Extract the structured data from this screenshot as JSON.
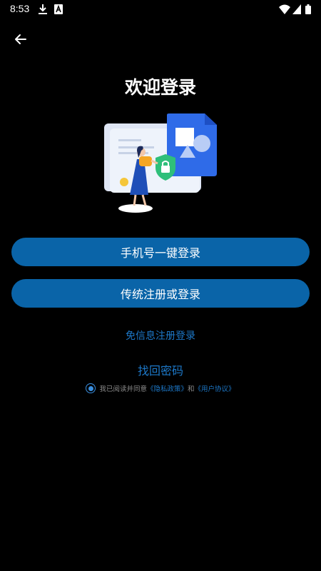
{
  "status_bar": {
    "time": "8:53"
  },
  "header": {
    "title": "欢迎登录"
  },
  "actions": {
    "phone_login_label": "手机号一键登录",
    "classic_login_label": "传统注册或登录",
    "quick_register_label": "免信息注册登录",
    "forgot_password_label": "找回密码"
  },
  "agreement": {
    "prefix": "我已阅读并同意",
    "privacy_label": "《隐私政策》",
    "conjunction": "和",
    "terms_label": "《用户协议》",
    "checked": true
  },
  "icons": {
    "status": [
      "download-icon",
      "a-icon",
      "wifi-icon",
      "signal-icon",
      "battery-icon"
    ],
    "back": "arrow-left-icon",
    "illustration": "login-security-illustration"
  },
  "colors": {
    "background": "#000000",
    "button": "#0a64a8",
    "link": "#1d78c8",
    "checkbox": "#3a8fe0"
  }
}
